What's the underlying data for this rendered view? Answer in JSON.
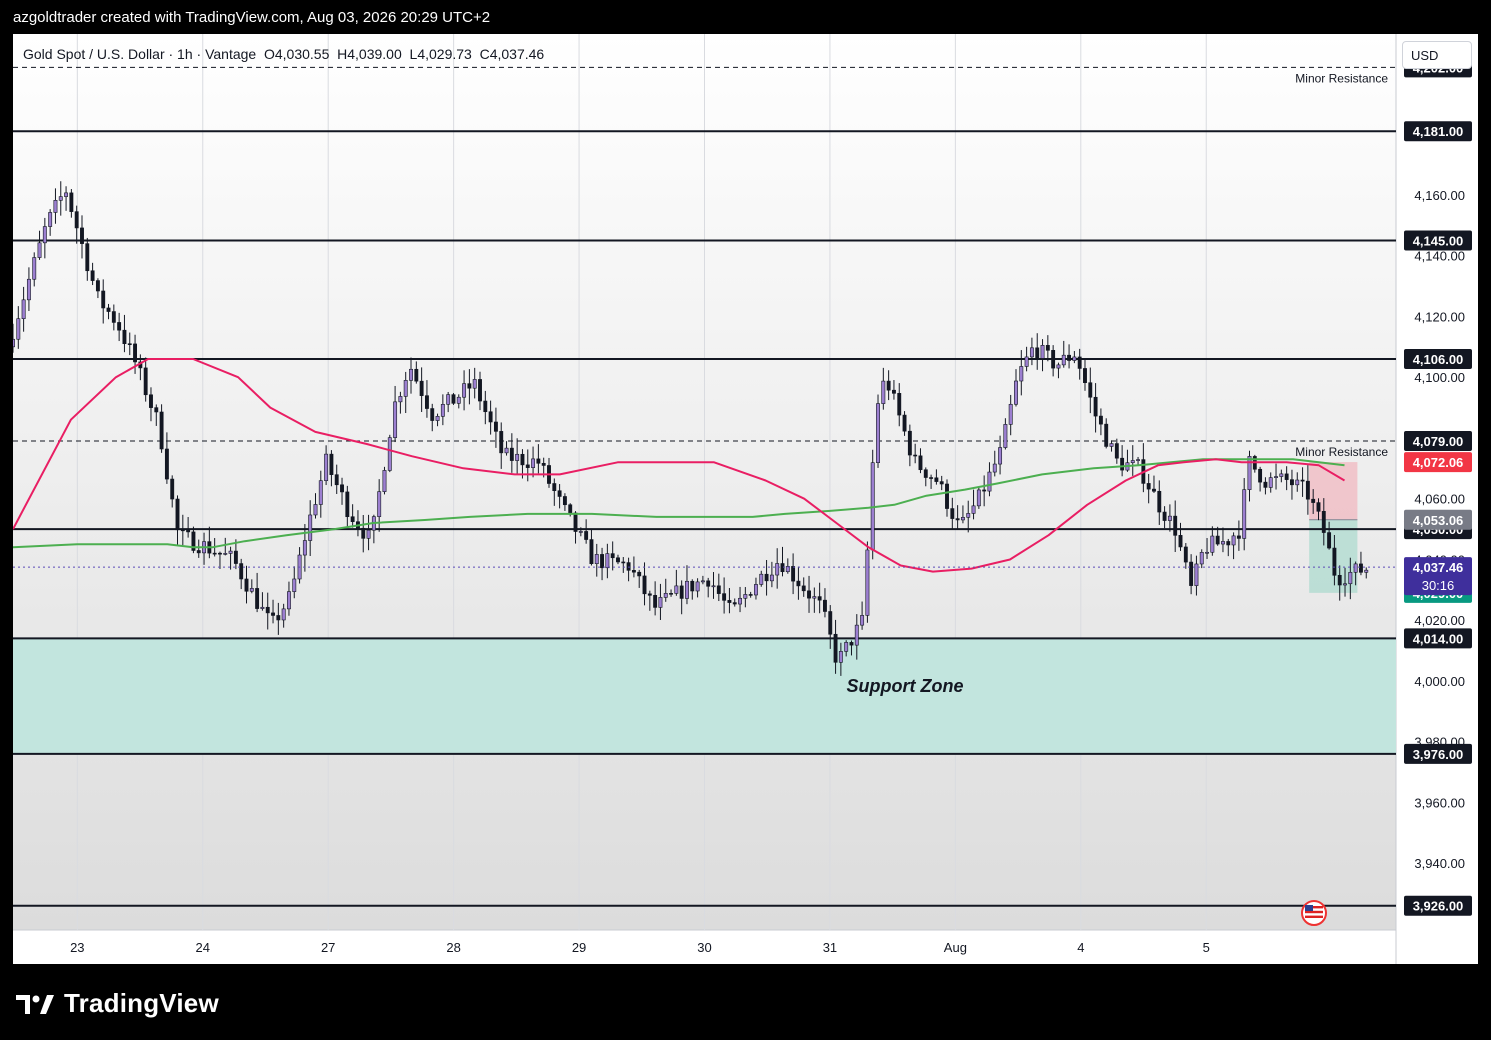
{
  "header": {
    "attribution": "azgoldtrader created with TradingView.com, Aug 03, 2026 20:29 UTC+2"
  },
  "legend": {
    "symbol": "Gold Spot / U.S. Dollar · 1h · Vantage",
    "open": "O4,030.55",
    "high": "H4,039.00",
    "low": "L4,029.73",
    "close": "C4,037.46"
  },
  "currency": "USD",
  "footer": {
    "brand": "TradingView"
  },
  "colors": {
    "bull": "#9c7fd0",
    "bear": "#131722",
    "ema_fast": "#e91e63",
    "ema_slow": "#4caf50",
    "support_zone": "#c2e5de",
    "line": "#131722"
  },
  "chart_data": {
    "type": "candlestick",
    "timeframe": "1h",
    "ylim": [
      3918,
      4213
    ],
    "y_ticks": [
      "4,160.00",
      "4,140.00",
      "4,120.00",
      "4,100.00",
      "4,060.00",
      "4,040.00",
      "4,020.00",
      "4,000.00",
      "3,980.00",
      "3,960.00",
      "3,940.00"
    ],
    "x_ticks": [
      "23",
      "24",
      "27",
      "28",
      "29",
      "30",
      "31",
      "Aug",
      "4",
      "5"
    ],
    "levels": [
      {
        "price": 4202.0,
        "label": "4,202.00",
        "style": "dashed",
        "note": "Minor Resistance"
      },
      {
        "price": 4181.0,
        "label": "4,181.00",
        "style": "solid"
      },
      {
        "price": 4145.0,
        "label": "4,145.00",
        "style": "solid"
      },
      {
        "price": 4106.0,
        "label": "4,106.00",
        "style": "solid"
      },
      {
        "price": 4079.0,
        "label": "4,079.00",
        "style": "dashed",
        "note": "Minor Resistance"
      },
      {
        "price": 4050.0,
        "label": "4,050.00",
        "style": "solid"
      },
      {
        "price": 4014.0,
        "label": "4,014.00",
        "style": "solid"
      },
      {
        "price": 3976.0,
        "label": "3,976.00",
        "style": "solid"
      },
      {
        "price": 3926.0,
        "label": "3,926.00",
        "style": "solid"
      }
    ],
    "support_zone": {
      "from": 3976,
      "to": 4014,
      "label": "Support Zone"
    },
    "position": {
      "entry": 4053.06,
      "stop": 4072.06,
      "target": 4029.0,
      "entry_label": "4,053.06",
      "stop_label": "4,072.06",
      "target_label": "4,029.00"
    },
    "last_price": {
      "value": 4037.46,
      "label": "4,037.46",
      "countdown": "30:16"
    },
    "anchors": [
      [
        0,
        4110
      ],
      [
        1.2,
        4150
      ],
      [
        1.8,
        4162
      ],
      [
        2.8,
        4126
      ],
      [
        3.4,
        4118
      ],
      [
        4,
        4104
      ],
      [
        4.7,
        4084
      ],
      [
        5.3,
        4048
      ],
      [
        6.2,
        4044
      ],
      [
        7,
        4040
      ],
      [
        8.2,
        4018
      ],
      [
        8.8,
        4028
      ],
      [
        9.3,
        4050
      ],
      [
        9.9,
        4072
      ],
      [
        10.6,
        4056
      ],
      [
        11.3,
        4046
      ],
      [
        12,
        4090
      ],
      [
        12.5,
        4104
      ],
      [
        13.2,
        4088
      ],
      [
        13.8,
        4092
      ],
      [
        14.5,
        4098
      ],
      [
        15.4,
        4074
      ],
      [
        16.5,
        4072
      ],
      [
        17.2,
        4058
      ],
      [
        18.2,
        4040
      ],
      [
        19.3,
        4038
      ],
      [
        20.1,
        4024
      ],
      [
        21,
        4030
      ],
      [
        21.8,
        4034
      ],
      [
        22.5,
        4022
      ],
      [
        23.2,
        4032
      ],
      [
        24,
        4040
      ],
      [
        25.3,
        4024
      ],
      [
        25.8,
        4006
      ],
      [
        26.6,
        4020
      ],
      [
        27,
        4090
      ],
      [
        27.3,
        4100
      ],
      [
        28.2,
        4072
      ],
      [
        28.9,
        4066
      ],
      [
        29.6,
        4050
      ],
      [
        30.2,
        4060
      ],
      [
        30.9,
        4076
      ],
      [
        31.4,
        4100
      ],
      [
        31.9,
        4110
      ],
      [
        32.6,
        4104
      ],
      [
        33.2,
        4108
      ],
      [
        33.8,
        4088
      ],
      [
        34.5,
        4072
      ],
      [
        35.2,
        4070
      ],
      [
        35.8,
        4058
      ],
      [
        36.3,
        4050
      ],
      [
        36.8,
        4030
      ],
      [
        37.2,
        4044
      ],
      [
        37.9,
        4046
      ],
      [
        38.3,
        4050
      ],
      [
        38.6,
        4072
      ],
      [
        39.1,
        4066
      ],
      [
        39.8,
        4066
      ],
      [
        40.4,
        4062
      ],
      [
        40.9,
        4050
      ],
      [
        41.3,
        4034
      ],
      [
        42.2,
        4037
      ]
    ],
    "ema_fast": [
      [
        0,
        4050
      ],
      [
        1.8,
        4086
      ],
      [
        3.2,
        4100
      ],
      [
        4.2,
        4106
      ],
      [
        5.6,
        4106
      ],
      [
        7,
        4100
      ],
      [
        8,
        4090
      ],
      [
        9.4,
        4082
      ],
      [
        11,
        4078
      ],
      [
        12.4,
        4074
      ],
      [
        14,
        4070
      ],
      [
        15.6,
        4068
      ],
      [
        17,
        4068
      ],
      [
        18.8,
        4072
      ],
      [
        19.8,
        4072
      ],
      [
        21.8,
        4072
      ],
      [
        23.4,
        4066
      ],
      [
        24.6,
        4060
      ],
      [
        25.6,
        4052
      ],
      [
        26.6,
        4044
      ],
      [
        27.6,
        4038
      ],
      [
        28.6,
        4036
      ],
      [
        29.8,
        4037
      ],
      [
        31,
        4040
      ],
      [
        32.2,
        4048
      ],
      [
        33.4,
        4058
      ],
      [
        34.6,
        4066
      ],
      [
        35.6,
        4071
      ],
      [
        36.4,
        4072
      ],
      [
        37.4,
        4073
      ],
      [
        38.2,
        4072
      ],
      [
        39.6,
        4072
      ],
      [
        40.6,
        4071
      ],
      [
        41.4,
        4066
      ]
    ],
    "ema_slow": [
      [
        0,
        4044
      ],
      [
        2,
        4045
      ],
      [
        3.5,
        4045
      ],
      [
        4.8,
        4045
      ],
      [
        5.6,
        4044
      ],
      [
        6.2,
        4044
      ],
      [
        7.2,
        4046
      ],
      [
        8.5,
        4048
      ],
      [
        10,
        4050
      ],
      [
        11.2,
        4052
      ],
      [
        12.8,
        4053
      ],
      [
        14.2,
        4054
      ],
      [
        16,
        4055
      ],
      [
        18,
        4055
      ],
      [
        20,
        4054
      ],
      [
        21.8,
        4054
      ],
      [
        23,
        4054
      ],
      [
        24,
        4055
      ],
      [
        25.4,
        4056
      ],
      [
        26.6,
        4057
      ],
      [
        27.4,
        4058
      ],
      [
        28.4,
        4061
      ],
      [
        29.6,
        4063
      ],
      [
        30.6,
        4065
      ],
      [
        32,
        4068
      ],
      [
        33.6,
        4070
      ],
      [
        35,
        4071
      ],
      [
        36,
        4072
      ],
      [
        37,
        4073
      ],
      [
        38,
        4073
      ],
      [
        39.8,
        4073
      ],
      [
        41.4,
        4071
      ]
    ],
    "x_domain": [
      0,
      43
    ]
  }
}
